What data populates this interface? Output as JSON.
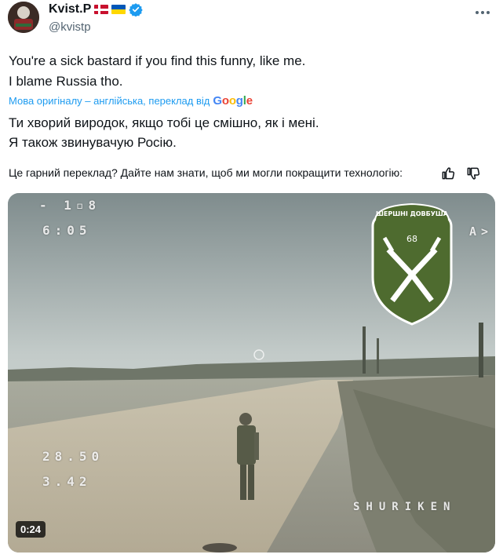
{
  "author": {
    "display_name": "Kvist.P",
    "handle": "@kvistp",
    "flags": [
      "denmark-flag",
      "ukraine-flag"
    ],
    "verified": true
  },
  "tweet": {
    "lines": [
      "You're a sick bastard if you find this funny, like me.",
      "I blame Russia tho."
    ]
  },
  "translation": {
    "attribution": "Мова оригіналу – англійська, переклад від",
    "provider": {
      "G": "G",
      "o1": "o",
      "o2": "o",
      "g": "g",
      "l": "l",
      "e": "e"
    },
    "lines": [
      "Ти хворий виродок, якщо тобі це смішно, як і мені.",
      "Я також звинувачую Росію."
    ],
    "feedback_prompt": "Це гарний переклад? Дайте нам знати, щоб ми могли покращити технологію:"
  },
  "media": {
    "duration": "0:24",
    "patch_text": "ШЕРШНІ ДОВБУША",
    "patch_number": "68",
    "osd": {
      "top_left_1": "- 1▫8",
      "top_left_2": "6:05",
      "mid_left_1": "28.50",
      "mid_left_2": "3.42",
      "bottom_right": "SHURIKEN",
      "right_edge": "A>"
    }
  },
  "colors": {
    "link": "#1d9bf0",
    "text": "#0f1419",
    "secondary": "#536471",
    "patch_green": "#4e6b2f"
  }
}
